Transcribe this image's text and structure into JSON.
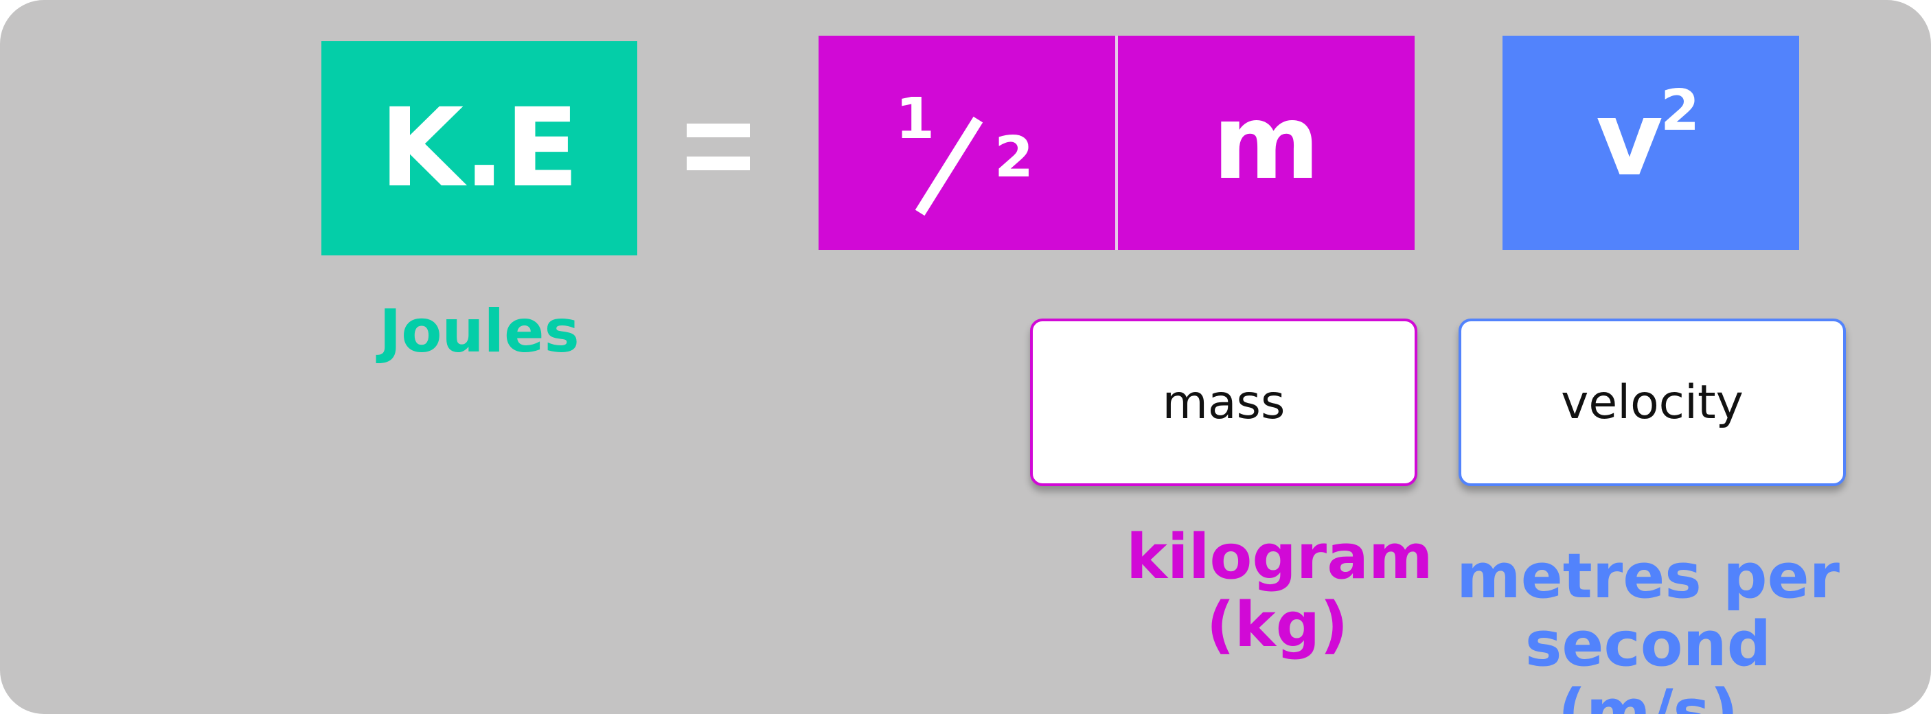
{
  "equation": {
    "lhs": "K.E",
    "equals": "=",
    "fraction_numerator": "1",
    "fraction_denominator": "2",
    "mass_symbol": "m",
    "velocity_symbol": "v",
    "velocity_exponent": "2"
  },
  "units": {
    "energy": "Joules",
    "mass_line1": "kilogram",
    "mass_line2": "(kg)",
    "velocity_line1": "metres per",
    "velocity_line2": "second (m/s)"
  },
  "cards": {
    "mass": "mass",
    "velocity": "velocity"
  },
  "colors": {
    "background": "#c4c3c3",
    "kinetic_energy": "#04cea8",
    "mass": "#d109d6",
    "velocity": "#5283fc"
  }
}
